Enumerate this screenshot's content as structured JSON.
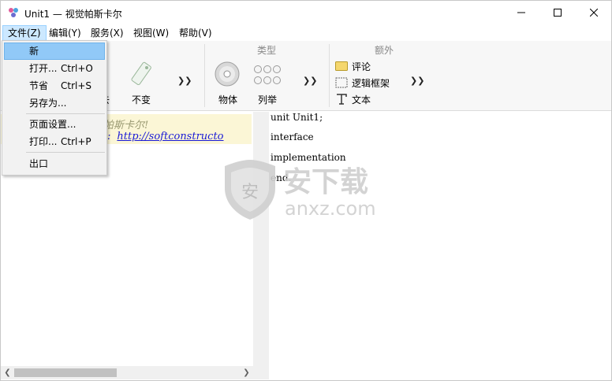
{
  "window": {
    "title": "Unit1 — 视觉帕斯卡尔"
  },
  "menubar": {
    "items": [
      "文件(Z)",
      "编辑(Y)",
      "服务(X)",
      "视图(W)",
      "帮助(V)"
    ]
  },
  "file_menu": {
    "items": [
      {
        "label": "新",
        "shortcut": ""
      },
      {
        "label": "打开...",
        "shortcut": "Ctrl+O"
      },
      {
        "label": "节省",
        "shortcut": "Ctrl+S"
      },
      {
        "label": "另存为...",
        "shortcut": ""
      },
      {
        "label": "页面设置...",
        "shortcut": ""
      },
      {
        "label": "打印...",
        "shortcut": "Ctrl+P"
      },
      {
        "label": "出口",
        "shortcut": ""
      }
    ]
  },
  "ribbon": {
    "partial_label_1": "去",
    "partial_label_2": "不变",
    "group_type": "类型",
    "group_extra": "额外",
    "btn_object": "物体",
    "btn_enum": "列举",
    "btn_comment": "评论",
    "btn_logic_frame": "逻辑框架",
    "btn_text": "文本"
  },
  "left_pane": {
    "note_text": "帕斯卡尔!",
    "note_prefix": ":",
    "note_link": "http://softconstructo"
  },
  "editor": {
    "lines": [
      "unit Unit1;",
      "interface",
      "implementation",
      "end."
    ]
  },
  "watermark": {
    "main": "安下载",
    "sub": "anxz.com",
    "badge": "安"
  },
  "colors": {
    "menu_active": "#cce8ff",
    "dropdown_highlight": "#91c9f7",
    "note_background": "#fbf6d6",
    "link": "#1a1ad6"
  }
}
